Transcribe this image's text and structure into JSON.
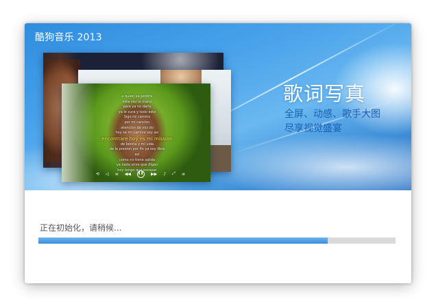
{
  "app_title": "酷狗音乐 2013",
  "feature": {
    "title": "歌词写真",
    "line1": "全屏、动感、歌手大图",
    "line2": "尽享视觉盛宴"
  },
  "preview": {
    "lyrics": [
      "a quien va pedirle",
      "esta vez la mano",
      "para ya no darlo",
      "ya le cura y todo este",
      "Sigo mi camino",
      "por mi cancion",
      "atencion de voz do",
      "hoy se mi camino soy asi",
      "encontrare hoy es mi mission",
      "de bonita y mi vida",
      "de la presion por fin ya soy libre",
      "asi",
      "como no tiene salida",
      "ya nada sirve que digan",
      "hoy tengo que escapar"
    ],
    "highlight_index": 8,
    "controls": [
      "⟲",
      "◁",
      "≡",
      "◀◀",
      "❚❚",
      "▶▶",
      "♪",
      "⤢",
      "≡"
    ]
  },
  "loading": {
    "status_text": "正在初始化，请稍候...",
    "progress": 0.81
  },
  "colors": {
    "accent_text": "#1a5fb4",
    "progress_fill": "#3d8edc",
    "progress_track": "#dadada"
  }
}
